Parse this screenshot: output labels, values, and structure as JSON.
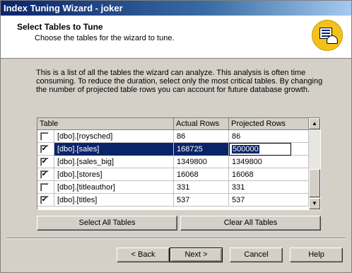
{
  "window": {
    "title": "Index Tuning Wizard - joker"
  },
  "header": {
    "title": "Select Tables to Tune",
    "subtitle": "Choose the tables for the wizard to tune."
  },
  "intro_text": "This is a list of all the tables the wizard can analyze. This analysis is often time consuming. To reduce the duration, select only the most critical tables. By changing the number of projected table rows you can account for future database growth.",
  "grid": {
    "columns": [
      "Table",
      "Actual Rows",
      "Projected Rows"
    ],
    "rows": [
      {
        "checked": false,
        "table": "[dbo].[roysched]",
        "actual": "86",
        "projected": "86"
      },
      {
        "checked": true,
        "table": "[dbo].[sales]",
        "actual": "168725",
        "projected": "500000",
        "selected": true
      },
      {
        "checked": true,
        "table": "[dbo].[sales_big]",
        "actual": "1349800",
        "projected": "1349800"
      },
      {
        "checked": true,
        "table": "[dbo].[stores]",
        "actual": "16068",
        "projected": "16068"
      },
      {
        "checked": false,
        "table": "[dbo].[titleauthor]",
        "actual": "331",
        "projected": "331"
      },
      {
        "checked": true,
        "table": "[dbo].[titles]",
        "actual": "537",
        "projected": "537"
      }
    ]
  },
  "buttons": {
    "select_all": "Select All Tables",
    "clear_all": "Clear All Tables",
    "back": "< Back",
    "next": "Next >",
    "cancel": "Cancel",
    "help": "Help"
  },
  "icons": {
    "wizard": "index-tuning-wizard-icon",
    "check": "✔"
  },
  "colors": {
    "selection": "#0a246a",
    "title_start": "#0a246a",
    "icon_bg": "#f3c21a"
  }
}
